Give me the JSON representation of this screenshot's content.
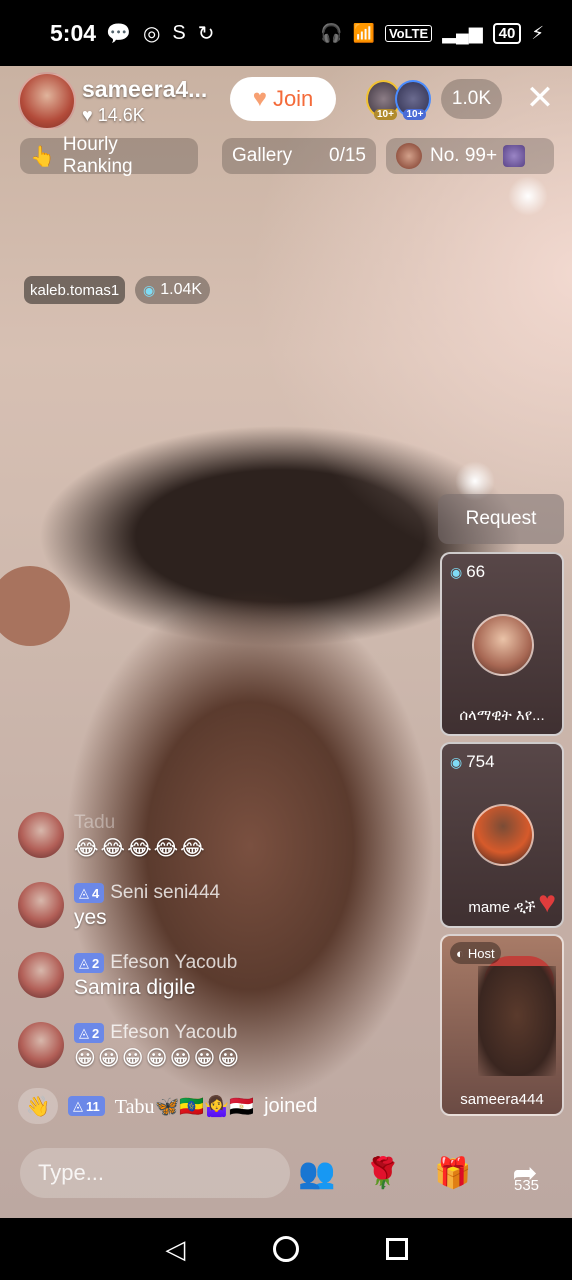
{
  "status_bar": {
    "time": "5:04",
    "battery": "40",
    "network_label": "VoLTE"
  },
  "host": {
    "name": "sameera4...",
    "likes": "14.6K",
    "join_label": "Join"
  },
  "viewers": {
    "badge_a": "10+",
    "badge_b": "10+",
    "count": "1.0K"
  },
  "chips": {
    "hourly_ranking": "Hourly Ranking",
    "gallery_label": "Gallery",
    "gallery_count": "0/15",
    "rank_label": "No. 99+"
  },
  "guest": {
    "tag": "kaleb.tomas1",
    "score": "1.04K"
  },
  "request_label": "Request",
  "slots": [
    {
      "score": "66",
      "name": "ሰላማዊት እየ..."
    },
    {
      "score": "754",
      "name": "mame ዲች"
    },
    {
      "badge": "Host",
      "name": "sameera444"
    }
  ],
  "chat": [
    {
      "user": "Tadu",
      "level": "",
      "text": "😂😂😂😂😂"
    },
    {
      "user": "Seni seni444",
      "level": "4",
      "text": "yes"
    },
    {
      "user": "Efeson Yacoub",
      "level": "2",
      "text": "Samira digile"
    },
    {
      "user": "Efeson Yacoub",
      "level": "2",
      "text": "😀😀😀😀😀😀😀"
    }
  ],
  "joined": {
    "level": "11",
    "user": "Tabu🦋🇪🇹🤷‍♀️🇪🇬",
    "suffix": "joined"
  },
  "bottom_bar": {
    "placeholder": "Type...",
    "share_count": "535"
  }
}
